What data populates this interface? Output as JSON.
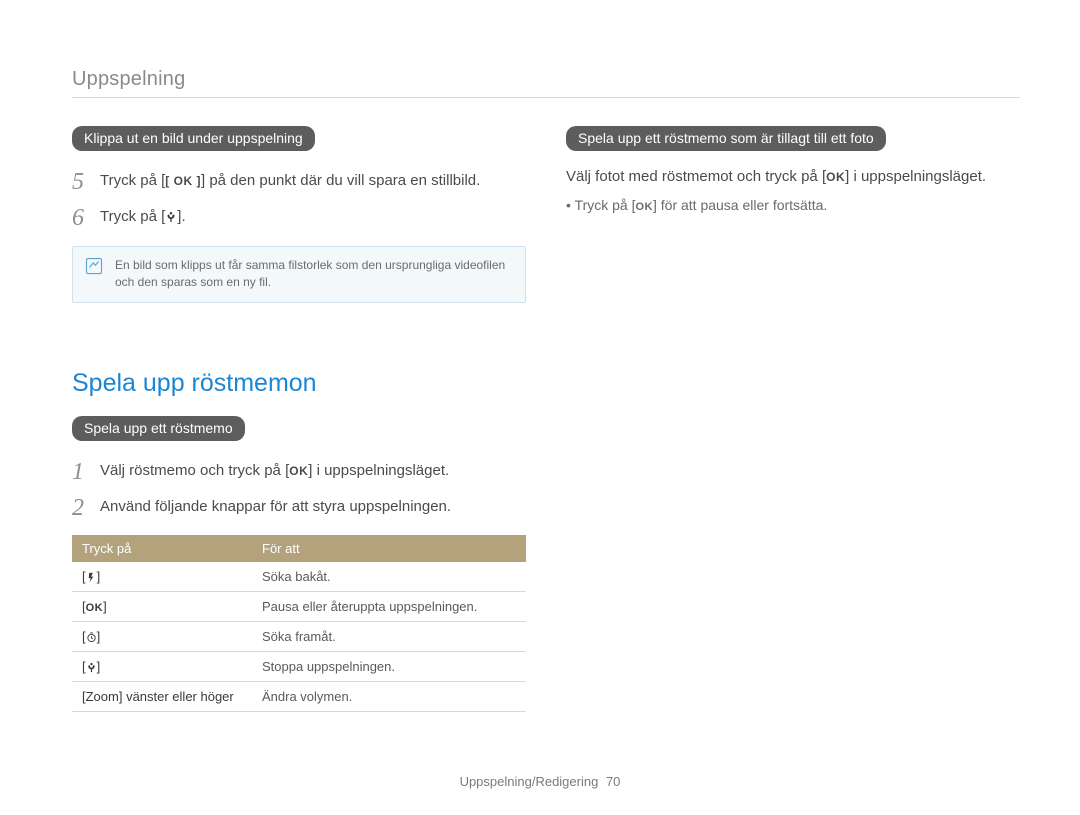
{
  "breadcrumb": "Uppspelning",
  "left": {
    "pill1": "Klippa ut en bild under uppspelning",
    "step5_before": "Tryck på ",
    "step5_ok": "OK",
    "step5_after": " på den punkt där du vill spara en stillbild.",
    "step6_before": "Tryck på ",
    "note": "En bild som klipps ut får samma filstorlek som den ursprungliga videofilen och den sparas som en ny fil.",
    "section_title": "Spela upp röstmemon",
    "pill2": "Spela upp ett röstmemo",
    "step1_before": "Välj röstmemo och tryck på ",
    "step1_ok": "OK",
    "step1_after": " i uppspelningsläget.",
    "step2": "Använd följande knappar för att styra uppspelningen.",
    "table": {
      "th1": "Tryck på",
      "th2": "För att",
      "rows": [
        {
          "key_icon": "flash",
          "desc": "Söka bakåt."
        },
        {
          "key_icon": "ok",
          "desc": "Pausa eller återuppta uppspelningen."
        },
        {
          "key_icon": "timer",
          "desc": "Söka framåt."
        },
        {
          "key_icon": "macro",
          "desc": "Stoppa uppspelningen."
        },
        {
          "key_text": "[Zoom] vänster eller höger",
          "desc": "Ändra volymen."
        }
      ]
    }
  },
  "right": {
    "pill": "Spela upp ett röstmemo som är tillagt till ett foto",
    "para_before": "Välj fotot med röstmemot och tryck på ",
    "para_ok": "OK",
    "para_after": " i uppspelningsläget.",
    "bullet_before": "Tryck på ",
    "bullet_ok": "OK",
    "bullet_after": " för att pausa eller fortsätta."
  },
  "footer": {
    "text": "Uppspelning/Redigering",
    "page": "70"
  }
}
